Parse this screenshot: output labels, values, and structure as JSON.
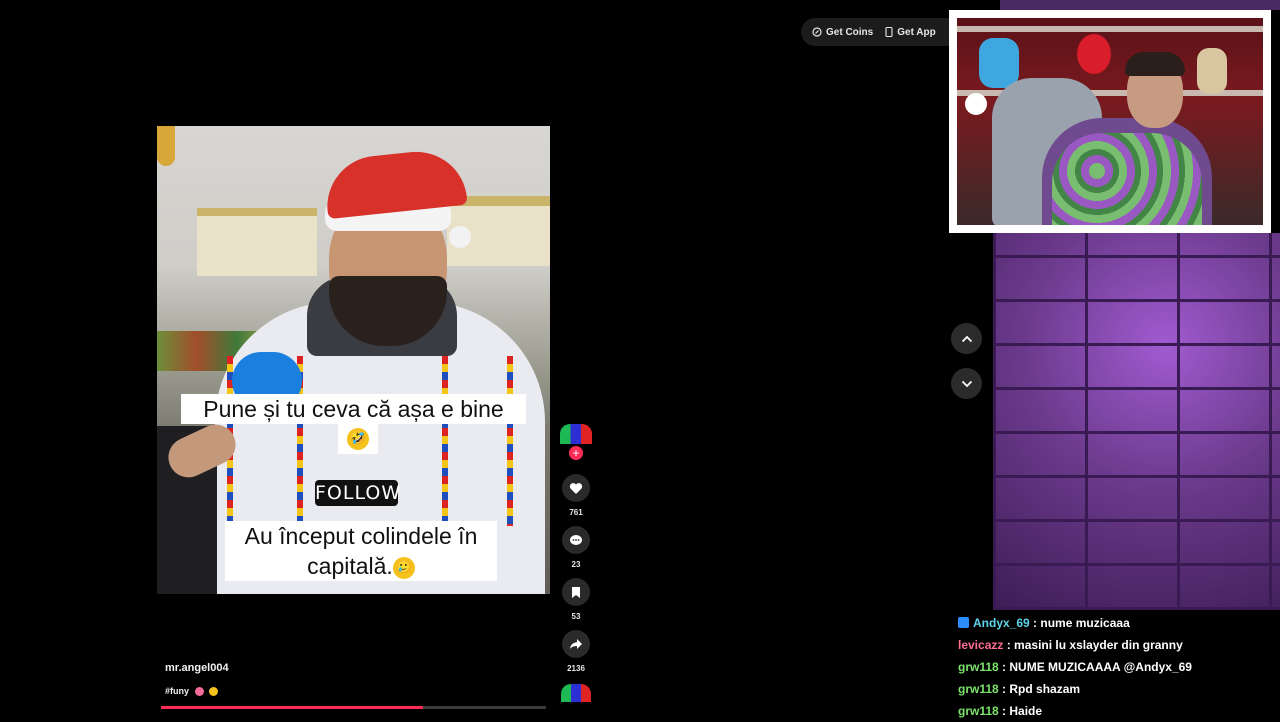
{
  "top_bar": {
    "get_coins_label": "Get Coins",
    "get_app_label": "Get App"
  },
  "video": {
    "caption_top_line1": "Pune și tu ceva că așa e bine",
    "caption_top_emoji": "🤣",
    "follow_label": "FOLLOW",
    "caption_bottom_line1": "Au început colindele în",
    "caption_bottom_line2": "capitală.",
    "caption_bottom_emoji": "🥲",
    "author": "mr.angel004",
    "tags": "#funy",
    "progress_percent": 68
  },
  "actions": {
    "likes": "761",
    "comments": "23",
    "saves": "53",
    "shares": "2136"
  },
  "chat": {
    "messages": [
      {
        "user": "Andyx_69",
        "text": "nume muzicaaa",
        "color": "#5fd3e8",
        "badge": true
      },
      {
        "user": "levicazz",
        "text": "masini lu xslayder din granny",
        "color": "#ff6f91",
        "badge": false
      },
      {
        "user": "grw118",
        "text": "NUME MUZICAAAA @Andyx_69",
        "color": "#7be36a",
        "badge": false
      },
      {
        "user": "grw118",
        "text": "Rpd shazam",
        "color": "#7be36a",
        "badge": false
      },
      {
        "user": "grw118",
        "text": "Haide",
        "color": "#7be36a",
        "badge": false
      }
    ]
  },
  "colors": {
    "accent": "#fe2c55",
    "wall": "#5b2f7a"
  },
  "icons": [
    "coin-icon",
    "phone-icon",
    "heart-icon",
    "comment-icon",
    "bookmark-icon",
    "share-icon",
    "chevron-up-icon",
    "chevron-down-icon"
  ]
}
